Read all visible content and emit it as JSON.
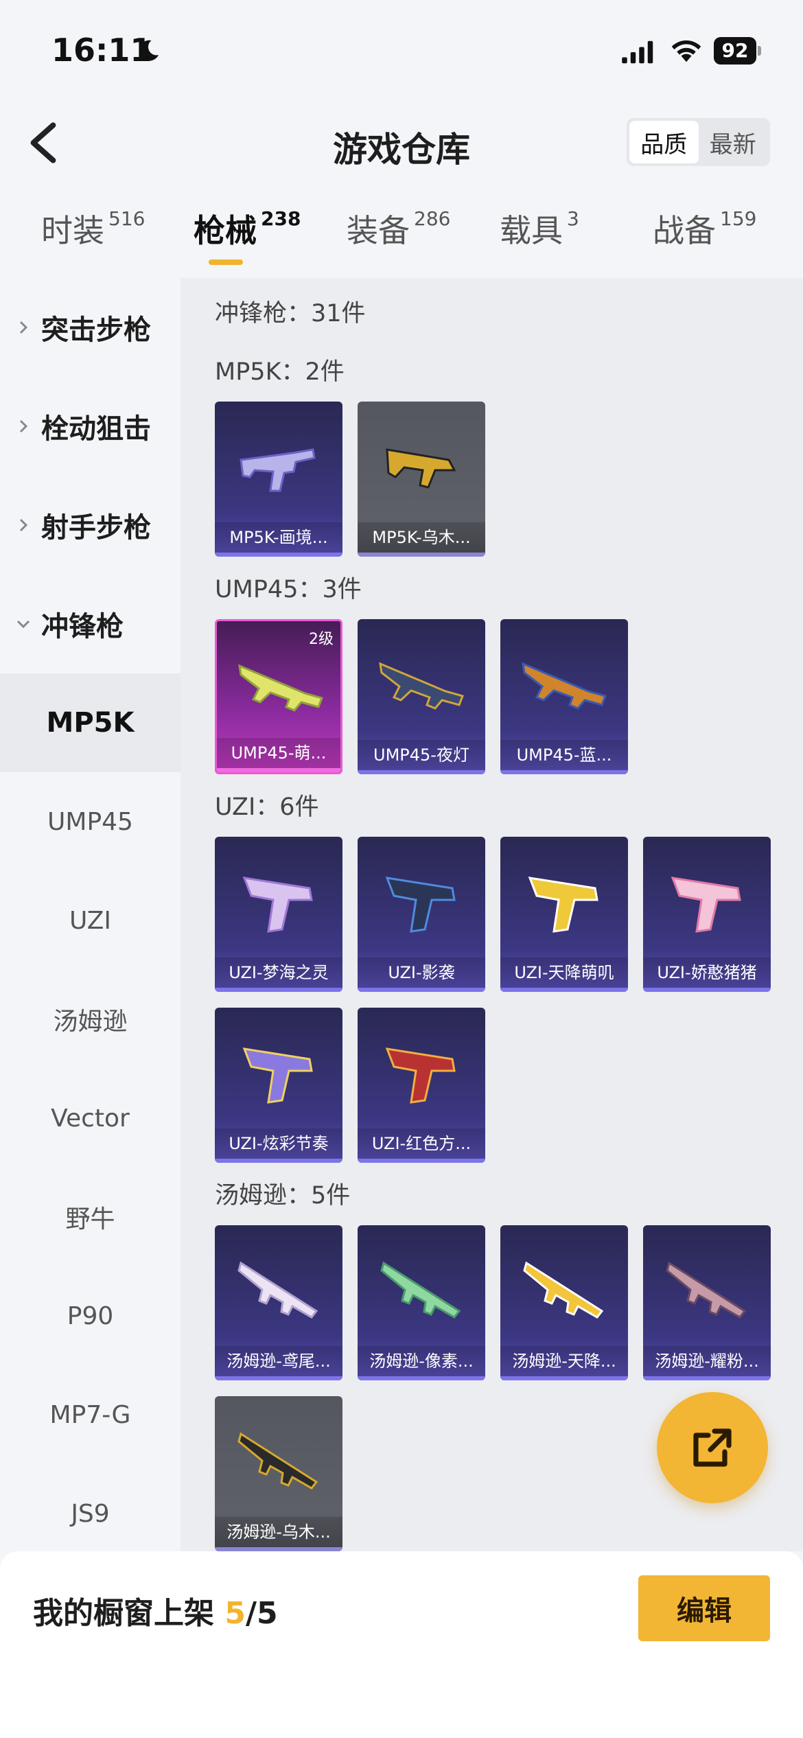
{
  "status_bar": {
    "time": "16:11",
    "battery": "92"
  },
  "header": {
    "title": "游戏仓库",
    "sort_options": [
      "品质",
      "最新"
    ]
  },
  "tabs": [
    {
      "label": "时装",
      "count": "516"
    },
    {
      "label": "枪械",
      "count": "238"
    },
    {
      "label": "装备",
      "count": "286"
    },
    {
      "label": "载具",
      "count": "3"
    },
    {
      "label": "战备",
      "count": "159"
    }
  ],
  "sidebar": {
    "categories": [
      "突击步枪",
      "栓动狙击",
      "射手步枪",
      "冲锋枪"
    ],
    "subitems": [
      "MP5K",
      "UMP45",
      "UZI",
      "汤姆逊",
      "Vector",
      "野牛",
      "P90",
      "MP7-G",
      "JS9"
    ]
  },
  "main": {
    "total_title": "冲锋枪：31件",
    "sections": [
      {
        "title": "MP5K：2件",
        "items": [
          {
            "label": "MP5K-画境...",
            "rarity": "purple"
          },
          {
            "label": "MP5K-乌木...",
            "rarity": "gray"
          }
        ]
      },
      {
        "title": "UMP45：3件",
        "items": [
          {
            "label": "UMP45-萌...",
            "rarity": "pink",
            "level": "2级"
          },
          {
            "label": "UMP45-夜灯",
            "rarity": "purple"
          },
          {
            "label": "UMP45-蓝...",
            "rarity": "purple"
          }
        ]
      },
      {
        "title": "UZI：6件",
        "items": [
          {
            "label": "UZI-梦海之灵",
            "rarity": "purple"
          },
          {
            "label": "UZI-影袭",
            "rarity": "purple"
          },
          {
            "label": "UZI-天降萌叽",
            "rarity": "purple"
          },
          {
            "label": "UZI-娇憨猪猪",
            "rarity": "purple"
          },
          {
            "label": "UZI-炫彩节奏",
            "rarity": "purple"
          },
          {
            "label": "UZI-红色方...",
            "rarity": "purple"
          }
        ]
      },
      {
        "title": "汤姆逊：5件",
        "items": [
          {
            "label": "汤姆逊-鸢尾...",
            "rarity": "purple"
          },
          {
            "label": "汤姆逊-像素...",
            "rarity": "purple"
          },
          {
            "label": "汤姆逊-天降...",
            "rarity": "purple"
          },
          {
            "label": "汤姆逊-耀粉...",
            "rarity": "purple"
          },
          {
            "label": "汤姆逊-乌木...",
            "rarity": "gray"
          }
        ]
      }
    ]
  },
  "bottom": {
    "showcase_prefix": "我的橱窗上架 ",
    "showcase_current": "5",
    "showcase_total": "/5",
    "edit_label": "编辑"
  },
  "colors": {
    "accent": "#f3b534",
    "purple_card": "#3c3782",
    "pink_card": "#c23bbf",
    "gray_card": "#5e6068"
  }
}
